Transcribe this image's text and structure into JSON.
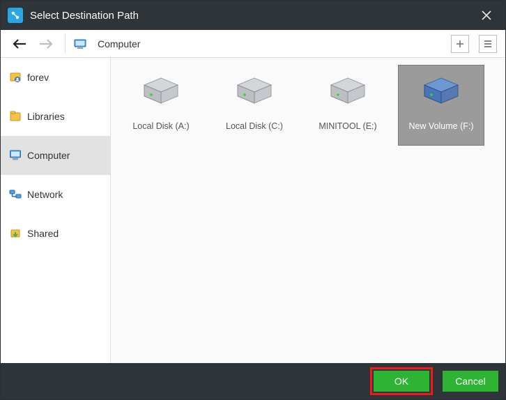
{
  "title": "Select Destination Path",
  "path_label": "Computer",
  "sidebar": {
    "items": [
      {
        "label": "forev"
      },
      {
        "label": "Libraries"
      },
      {
        "label": "Computer"
      },
      {
        "label": "Network"
      },
      {
        "label": "Shared"
      }
    ],
    "selected_index": 2
  },
  "drives": [
    {
      "label": "Local Disk (A:)",
      "color": "gray"
    },
    {
      "label": "Local Disk (C:)",
      "color": "gray"
    },
    {
      "label": "MINITOOL (E:)",
      "color": "gray"
    },
    {
      "label": "New Volume (F:)",
      "color": "blue"
    }
  ],
  "drives_selected_index": 3,
  "buttons": {
    "ok": "OK",
    "cancel": "Cancel"
  }
}
